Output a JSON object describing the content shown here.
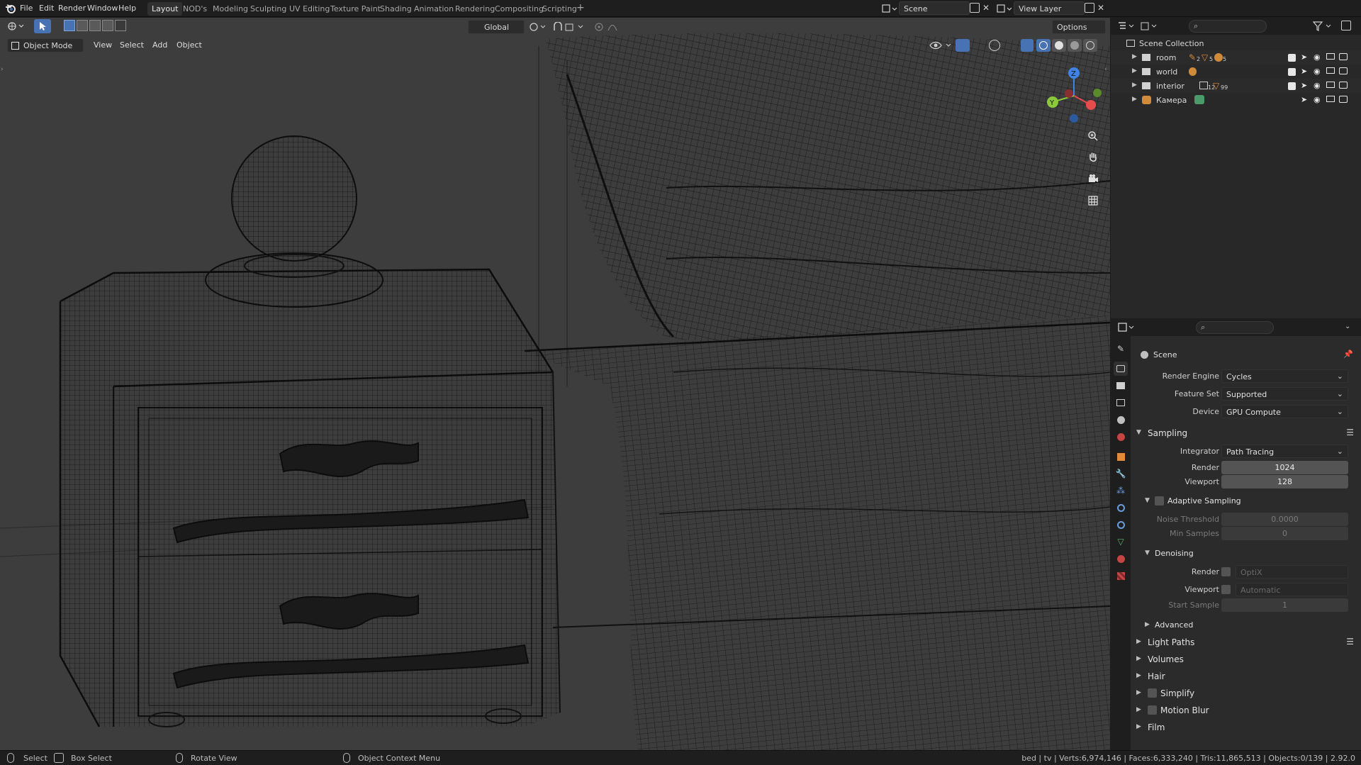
{
  "topbar": {
    "menu": [
      "File",
      "Edit",
      "Render",
      "Window",
      "Help"
    ],
    "workspaces": [
      "Layout",
      "NOD's",
      "Modeling",
      "Sculpting",
      "UV Editing",
      "Texture Paint",
      "Shading",
      "Animation",
      "Rendering",
      "Compositing",
      "Scripting"
    ],
    "active_workspace": "Layout",
    "scene_name": "Scene",
    "view_layer": "View Layer"
  },
  "viewport": {
    "mode": "Object Mode",
    "menu": [
      "View",
      "Select",
      "Add",
      "Object"
    ],
    "transform_orientation": "Global",
    "options_label": "Options",
    "shading": "wireframe"
  },
  "outliner": {
    "root": "Scene Collection",
    "rows": [
      {
        "name": "room",
        "count_a": "2",
        "count_b": "5",
        "count_c": "5"
      },
      {
        "name": "world"
      },
      {
        "name": "interior",
        "count_a": "12",
        "count_b": "99"
      },
      {
        "name": "Камера"
      }
    ]
  },
  "properties": {
    "context": "Scene",
    "render_engine_label": "Render Engine",
    "render_engine": "Cycles",
    "feature_set_label": "Feature Set",
    "feature_set": "Supported",
    "device_label": "Device",
    "device": "GPU Compute",
    "sampling": {
      "title": "Sampling",
      "integrator_label": "Integrator",
      "integrator": "Path Tracing",
      "render_label": "Render",
      "render": "1024",
      "viewport_label": "Viewport",
      "viewport": "128",
      "adaptive_title": "Adaptive Sampling",
      "noise_threshold_label": "Noise Threshold",
      "noise_threshold": "0.0000",
      "min_samples_label": "Min Samples",
      "min_samples": "0",
      "denoising_title": "Denoising",
      "denoise_render_label": "Render",
      "denoise_render": "OptiX",
      "denoise_viewport_label": "Viewport",
      "denoise_viewport": "Automatic",
      "start_sample_label": "Start Sample",
      "start_sample": "1",
      "advanced_title": "Advanced"
    },
    "panels": [
      "Light Paths",
      "Volumes",
      "Hair",
      "Simplify",
      "Motion Blur",
      "Film"
    ]
  },
  "statusbar": {
    "select": "Select",
    "box_select": "Box Select",
    "rotate_view": "Rotate View",
    "context_menu": "Object Context Menu",
    "stats": "bed | tv | Verts:6,974,146 | Faces:6,333,240 | Tris:11,865,513 | Objects:0/139 | 2.92.0"
  },
  "colors": {
    "accent_blue": "#4772b3",
    "axis_x": "#e74c4c",
    "axis_y": "#8bc93a",
    "axis_z": "#3f83e6",
    "wire": "#0d0d0d"
  }
}
